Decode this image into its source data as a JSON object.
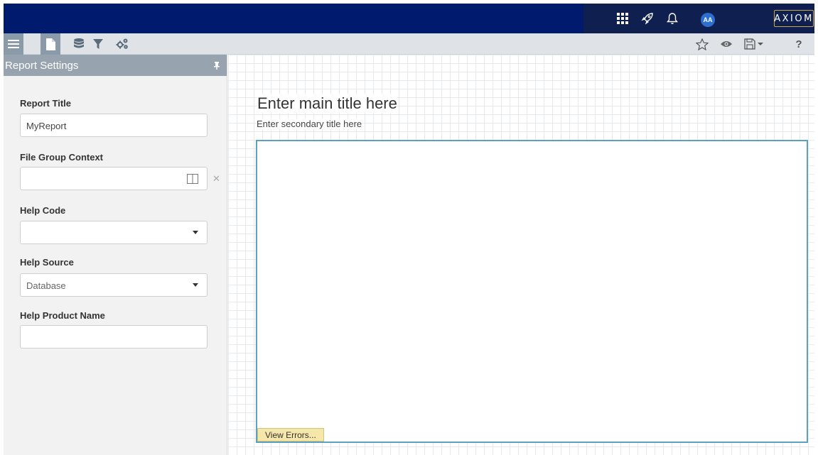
{
  "topbar": {
    "logo_text": "AXIOM",
    "avatar_initials": "AA",
    "icons": [
      "apps-grid-icon",
      "rocket-icon",
      "bell-icon"
    ]
  },
  "toolbar": {
    "left_icons": [
      "hamburger-menu-icon",
      "document-icon",
      "database-icon",
      "filter-icon",
      "settings-gears-icon"
    ],
    "right_icons": [
      "star-icon",
      "eye-icon",
      "save-dropdown-icon",
      "help-icon"
    ],
    "help_label": "?"
  },
  "sidebar": {
    "title": "Report Settings",
    "fields": {
      "report_title_label": "Report Title",
      "report_title_value": "MyReport",
      "file_group_label": "File Group Context",
      "file_group_value": "",
      "help_code_label": "Help Code",
      "help_code_value": "",
      "help_source_label": "Help Source",
      "help_source_value": "Database",
      "help_product_label": "Help Product Name",
      "help_product_value": ""
    }
  },
  "canvas": {
    "main_title": "Enter main title here",
    "secondary_title": "Enter secondary title here",
    "view_errors_label": "View Errors..."
  },
  "colors": {
    "topbar": "#001a6e",
    "sidebar_header": "#97a4af",
    "frame_border": "#5aa2c0",
    "view_errors_bg": "#f5e6a9"
  }
}
